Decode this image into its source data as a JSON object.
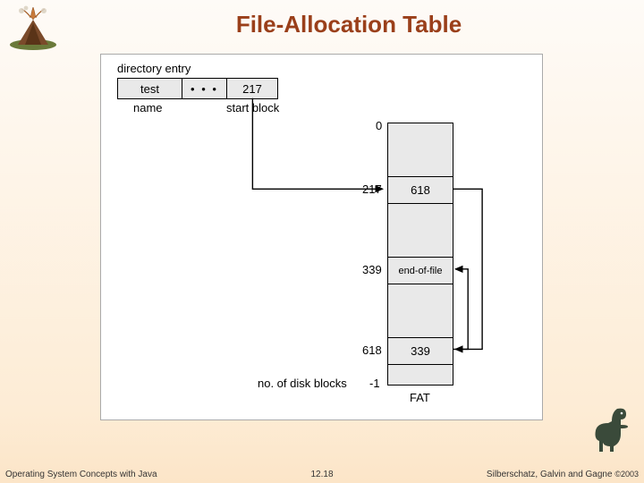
{
  "title": "File-Allocation Table",
  "footer": {
    "left": "Operating System Concepts with Java",
    "center": "12.18",
    "right_text": "Silberschatz, Galvin and Gagne ",
    "right_copy": "©2003"
  },
  "diagram": {
    "directory_entry_label": "directory entry",
    "name_label": "name",
    "start_block_label": "start block",
    "dir_entry": {
      "name": "test",
      "ellipsis": "• • •",
      "start_block": "217"
    },
    "fat_label_bottom": "FAT",
    "no_disk_blocks_label": "no. of disk blocks",
    "indices": {
      "top": "0",
      "i217": "217",
      "i339": "339",
      "i618": "618",
      "bottom": "-1"
    },
    "fat_cells": {
      "c217": "618",
      "c339": "end-of-file",
      "c618": "339"
    }
  }
}
